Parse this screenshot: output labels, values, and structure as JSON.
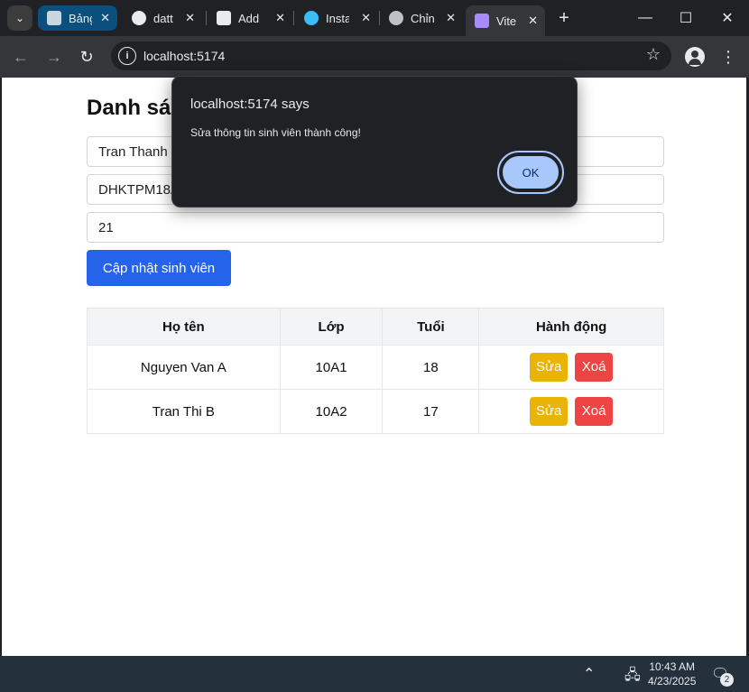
{
  "browser": {
    "tabs": [
      {
        "title": "Bảng",
        "favicon_color": "#c9d6df"
      },
      {
        "title": "datt",
        "favicon_color": "#e8eaed"
      },
      {
        "title": "Add",
        "favicon_color": "#e8eaed"
      },
      {
        "title": "Insta",
        "favicon_color": "#38bdf8"
      },
      {
        "title": "Chỉn",
        "favicon_color": "#bdc1c6"
      },
      {
        "title": "Vite",
        "favicon_color": "#a78bfa"
      }
    ],
    "url": "localhost:5174"
  },
  "page": {
    "title": "Danh sách sinh viên",
    "fields": {
      "name_value": "Tran Thanh",
      "class_value": "DHKTPM18A",
      "age_value": "21"
    },
    "submit_label": "Cập nhật sinh viên",
    "table": {
      "headers": [
        "Họ tên",
        "Lớp",
        "Tuổi",
        "Hành động"
      ],
      "rows": [
        {
          "name": "Nguyen Van A",
          "class": "10A1",
          "age": "18"
        },
        {
          "name": "Tran Thi B",
          "class": "10A2",
          "age": "17"
        }
      ],
      "edit_label": "Sửa",
      "delete_label": "Xoá"
    }
  },
  "dialog": {
    "title": "localhost:5174 says",
    "message": "Sửa thông tin sinh viên thành công!",
    "ok_label": "OK"
  },
  "taskbar": {
    "time": "10:43 AM",
    "date": "4/23/2025",
    "notification_count": "2"
  },
  "colors": {
    "primary": "#2563eb",
    "edit": "#eab308",
    "delete": "#ef4444"
  }
}
